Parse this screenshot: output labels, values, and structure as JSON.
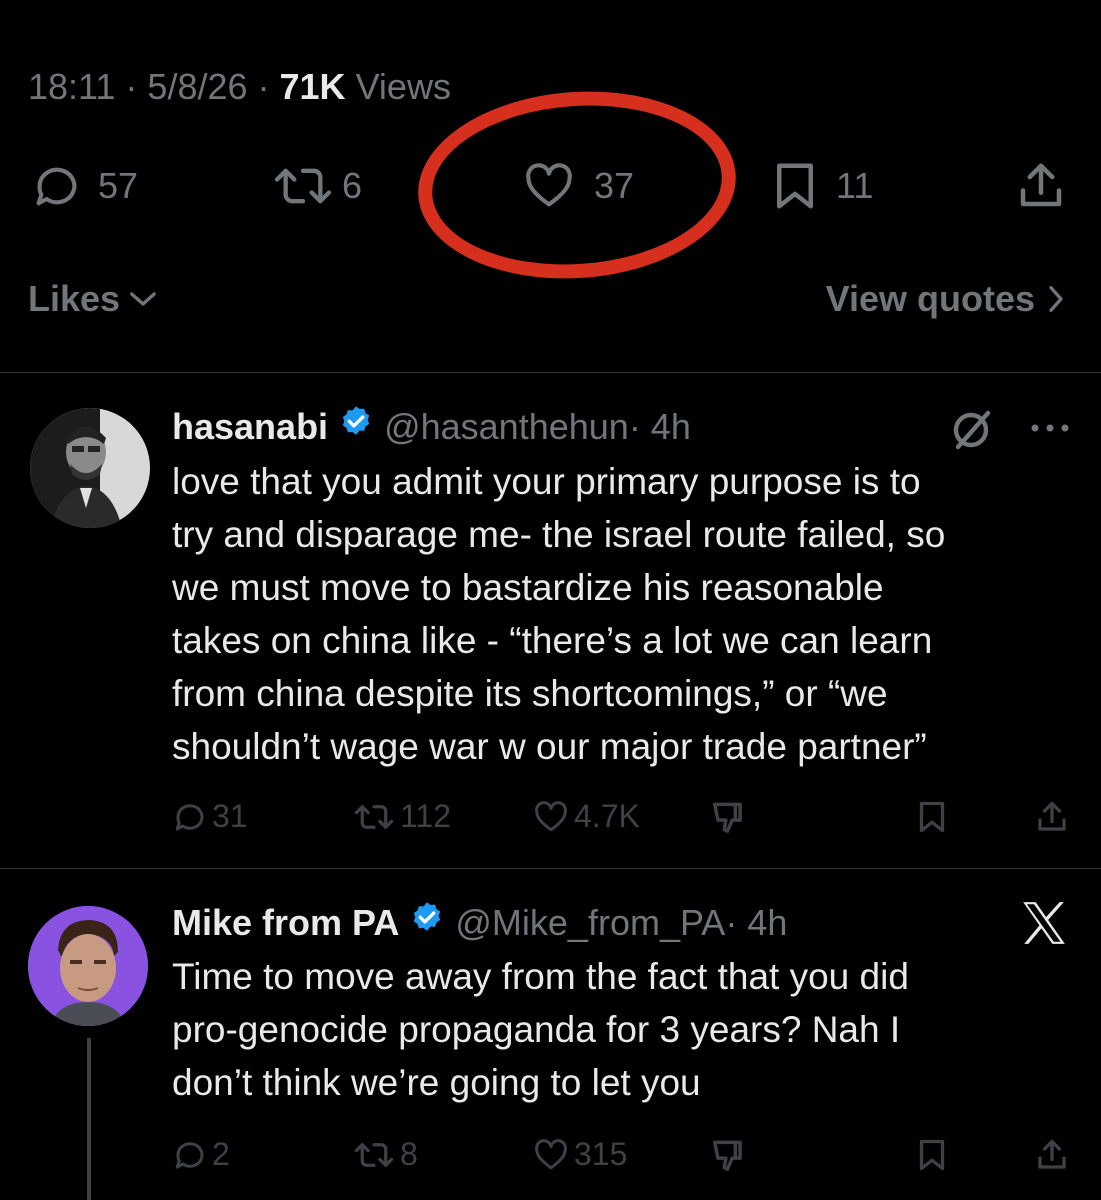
{
  "meta": {
    "time": "18:11",
    "sep1": " · ",
    "date": "5/8/26",
    "sep2": " · ",
    "views_count": "71K",
    "views_label": " Views"
  },
  "actions": {
    "replies": "57",
    "reposts": "6",
    "likes": "37",
    "bookmarks": "11"
  },
  "links": {
    "likes": "Likes",
    "view_quotes": "View quotes"
  },
  "replies": [
    {
      "name": "hasanabi",
      "handle": "@hasanthehun",
      "time": " · 4h",
      "text": [
        "love that you admit your primary purpose is to",
        "try and disparage me- the israel route failed, so",
        "we must move to bastardize his reasonable",
        "takes on china like - “there’s a lot we can learn",
        "from china despite its shortcomings,” or “we",
        "shouldn’t wage war w our major trade partner”"
      ],
      "replies": "31",
      "reposts": "112",
      "likes": "4.7K"
    },
    {
      "name": "Mike from PA",
      "handle": "@Mike_from_PA",
      "time": " · 4h",
      "text": [
        "Time to move away from the fact that you did",
        "pro-genocide propaganda for 3 years? Nah I",
        "don’t think we’re going to let you"
      ],
      "replies": "2",
      "reposts": "8",
      "likes": "315"
    }
  ],
  "colors": {
    "background": "#000000",
    "text_primary": "#e7e9ea",
    "text_secondary": "#71767b",
    "verified": "#1d9bf0",
    "annotation": "#d62f1e",
    "divider": "#2f3336"
  }
}
